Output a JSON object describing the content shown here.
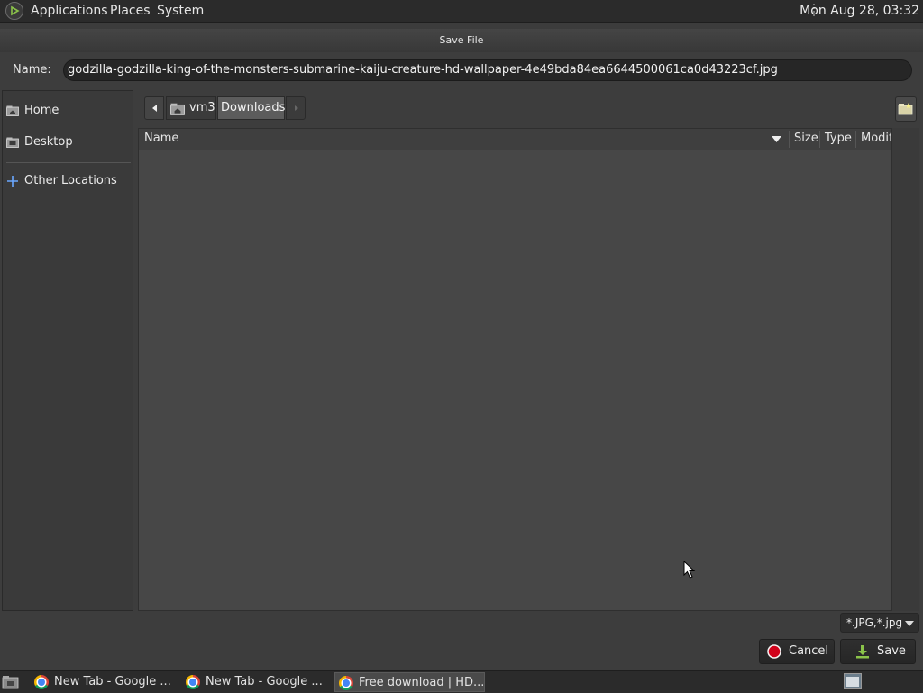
{
  "top_panel": {
    "menus": [
      "Applications",
      "Places",
      "System"
    ],
    "clock": "Mon Aug 28, 03:32"
  },
  "dialog": {
    "title": "Save File",
    "name_label": "Name:",
    "file_name": "godzilla-godzilla-king-of-the-monsters-submarine-kaiju-creature-hd-wallpaper-4e49bda84ea6644500061ca0d43223cf.jpg",
    "sidebar": {
      "items": [
        {
          "label": "Home",
          "icon": "home-folder-icon"
        },
        {
          "label": "Desktop",
          "icon": "desktop-folder-icon"
        },
        {
          "label": "Other Locations",
          "icon": "plus-icon"
        }
      ]
    },
    "path_bar": {
      "crumbs": [
        "vm3",
        "Downloads"
      ],
      "active": "Downloads"
    },
    "file_list": {
      "columns": [
        "Name",
        "Size",
        "Type",
        "Modif"
      ],
      "rows": []
    },
    "file_filter": "*.JPG,*.jpg",
    "buttons": {
      "cancel": "Cancel",
      "save": "Save"
    }
  },
  "taskbar": {
    "tasks": [
      {
        "label": "New Tab - Google ...",
        "active": false
      },
      {
        "label": "New Tab - Google ...",
        "active": false
      },
      {
        "label": "Free download | HD...",
        "active": true
      }
    ]
  },
  "colors": {
    "panel_bg": "#2b2b2b",
    "dialog_bg": "#3d3d3d",
    "cancel_icon": "#d0021b",
    "save_icon": "#8bc34a"
  }
}
